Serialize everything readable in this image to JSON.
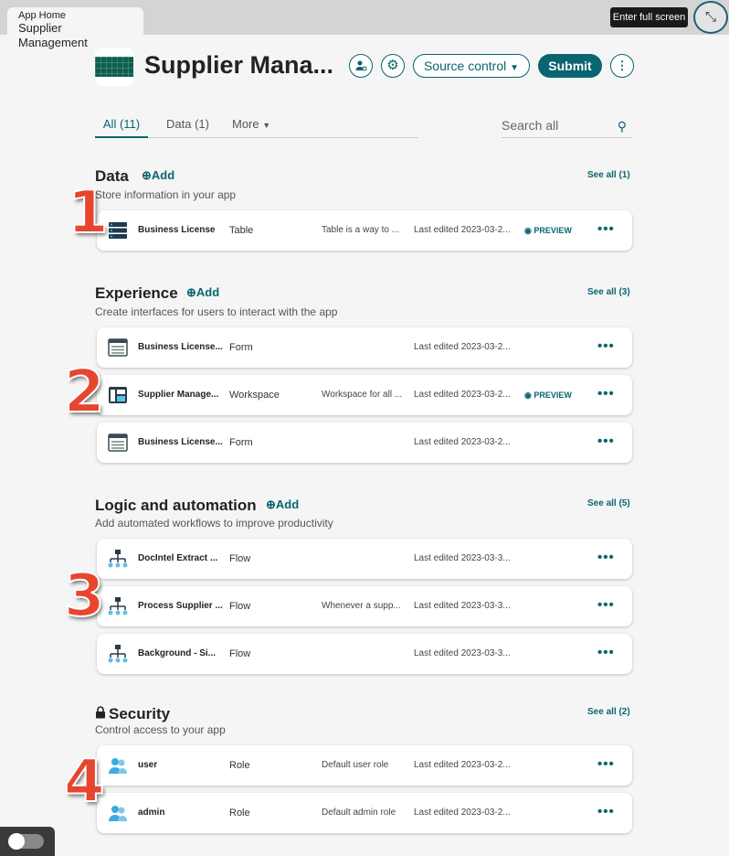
{
  "window": {
    "tab_label": "App Home",
    "tab_title": "Supplier Management",
    "fullscreen_tooltip": "Enter full screen"
  },
  "header": {
    "app_title": "Supplier Mana...",
    "source_control_label": "Source control",
    "submit_label": "Submit"
  },
  "tabs": [
    {
      "label": "All (11)"
    },
    {
      "label": "Data (1)"
    },
    {
      "label": "More"
    }
  ],
  "search": {
    "placeholder": "Search all"
  },
  "sections": {
    "data": {
      "title": "Data",
      "add_label": "Add",
      "description": "Store information in your app",
      "see_all": "See all (1)",
      "items": [
        {
          "name": "Business License",
          "type": "Table",
          "description": "Table is a way to ...",
          "edited": "Last edited 2023-03-2...",
          "preview": "PREVIEW",
          "icon": "table-icon"
        }
      ]
    },
    "experience": {
      "title": "Experience",
      "add_label": "Add",
      "description": "Create interfaces for users to interact with the app",
      "see_all": "See all (3)",
      "items": [
        {
          "name": "Business License...",
          "type": "Form",
          "description": "",
          "edited": "Last edited 2023-03-2...",
          "preview": "",
          "icon": "form-icon"
        },
        {
          "name": "Supplier Manage...",
          "type": "Workspace",
          "description": "Workspace for all ...",
          "edited": "Last edited 2023-03-2...",
          "preview": "PREVIEW",
          "icon": "workspace-icon"
        },
        {
          "name": "Business License...",
          "type": "Form",
          "description": "",
          "edited": "Last edited 2023-03-2...",
          "preview": "",
          "icon": "form-icon"
        }
      ]
    },
    "logic": {
      "title": "Logic and automation",
      "add_label": "Add",
      "description": "Add automated workflows to improve productivity",
      "see_all": "See all (5)",
      "items": [
        {
          "name": "DocIntel Extract ...",
          "type": "Flow",
          "description": "",
          "edited": "Last edited 2023-03-3...",
          "preview": "",
          "icon": "flow-icon"
        },
        {
          "name": "Process Supplier ...",
          "type": "Flow",
          "description": "Whenever a supp...",
          "edited": "Last edited 2023-03-3...",
          "preview": "",
          "icon": "flow-icon"
        },
        {
          "name": "Background - Si...",
          "type": "Flow",
          "description": "",
          "edited": "Last edited 2023-03-3...",
          "preview": "",
          "icon": "flow-icon"
        }
      ]
    },
    "security": {
      "title": "Security",
      "description": "Control access to your app",
      "see_all": "See all (2)",
      "items": [
        {
          "name": "user",
          "type": "Role",
          "description": "Default user role",
          "edited": "Last edited 2023-03-2...",
          "preview": "",
          "icon": "role-icon"
        },
        {
          "name": "admin",
          "type": "Role",
          "description": "Default admin role",
          "edited": "Last edited 2023-03-2...",
          "preview": "",
          "icon": "role-icon"
        }
      ]
    }
  },
  "callouts": [
    "1",
    "2",
    "3",
    "4"
  ],
  "colors": {
    "accent": "#0a6570",
    "callout": "#e8452e",
    "background": "#f5f5f5"
  }
}
